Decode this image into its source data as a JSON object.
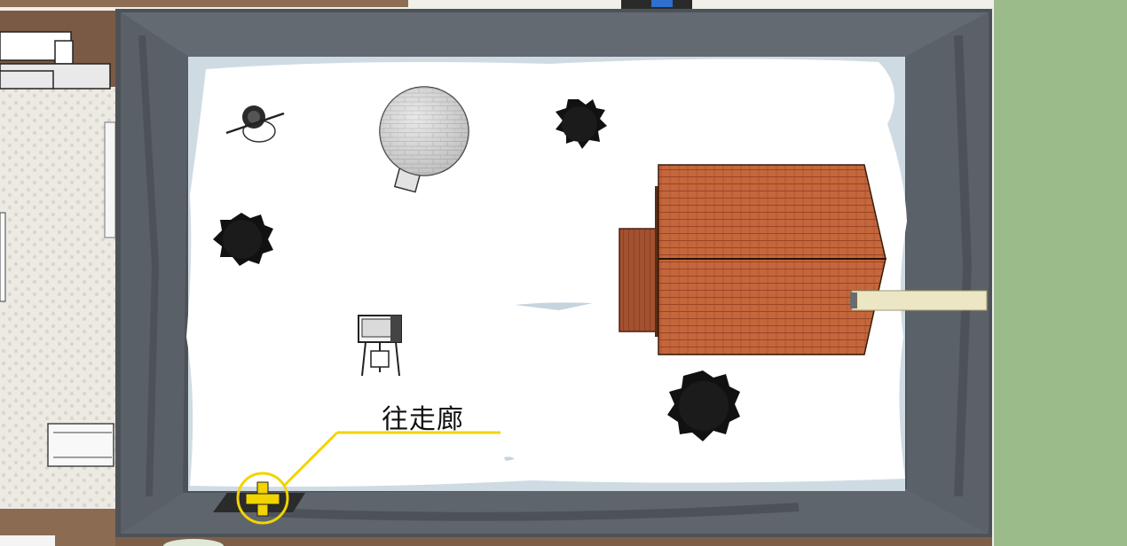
{
  "scene": {
    "name": "snowy-courtyard-top-down",
    "objects": [
      {
        "name": "snowman",
        "icon": "snowman-icon"
      },
      {
        "name": "hot-air-balloon",
        "icon": "balloon-icon"
      },
      {
        "name": "shrub",
        "icon": "bush-icon"
      },
      {
        "name": "shrub",
        "icon": "bush-icon"
      },
      {
        "name": "shrub",
        "icon": "bush-icon"
      },
      {
        "name": "cabin",
        "icon": "cabin-icon"
      },
      {
        "name": "telescope",
        "icon": "telescope-icon"
      }
    ]
  },
  "exit": {
    "label": "往走廊",
    "icon": "plus-icon",
    "color": "#f2d400"
  },
  "colors": {
    "floor": "#e8e8e6",
    "grass": "#9bbb8b",
    "wall": "#555a60",
    "roof": "#c4673c"
  }
}
